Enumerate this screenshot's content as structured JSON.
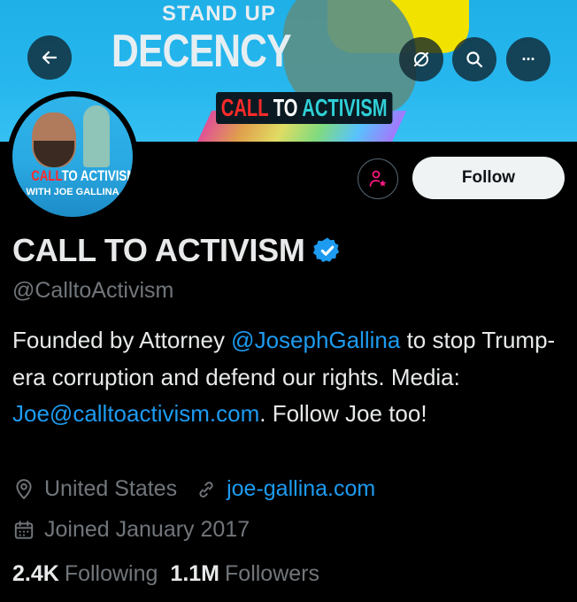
{
  "banner": {
    "line1": "STAND UP",
    "line2": "DECENCY",
    "cta_call": "CALL",
    "cta_to": "TO",
    "cta_activism": "ACTIVISM"
  },
  "top_buttons": {
    "back_icon": "arrow-left-icon",
    "grok_icon": "grok-icon",
    "search_icon": "search-icon",
    "more_icon": "more-horizontal-icon",
    "more_label": "···"
  },
  "avatar": {
    "call": "CALL",
    "to_activism": "TO ACTIVISM",
    "with": "WITH JOE GALLINA"
  },
  "actions": {
    "subscribe_icon": "person-star-icon",
    "follow_label": "Follow"
  },
  "profile": {
    "name": "CALL TO ACTIVISM",
    "handle": "@CalltoActivism",
    "verified_icon": "verified-badge-icon",
    "bio": {
      "part1": "Founded by Attorney ",
      "mention": "@JosephGallina",
      "part2": " to stop Trump-era corruption and defend our rights. Media: ",
      "email": "Joe@calltoactivism.com",
      "part3": ". Follow Joe too!"
    },
    "location": "United States",
    "website": "joe-gallina.com",
    "joined": "Joined January 2017",
    "following_count": "2.4K",
    "following_label": "Following",
    "followers_count": "1.1M",
    "followers_label": "Followers"
  },
  "colors": {
    "accent": "#1d9bf0",
    "muted": "#71767b",
    "banner": "#27b7ee",
    "subscribe": "#f91880"
  }
}
